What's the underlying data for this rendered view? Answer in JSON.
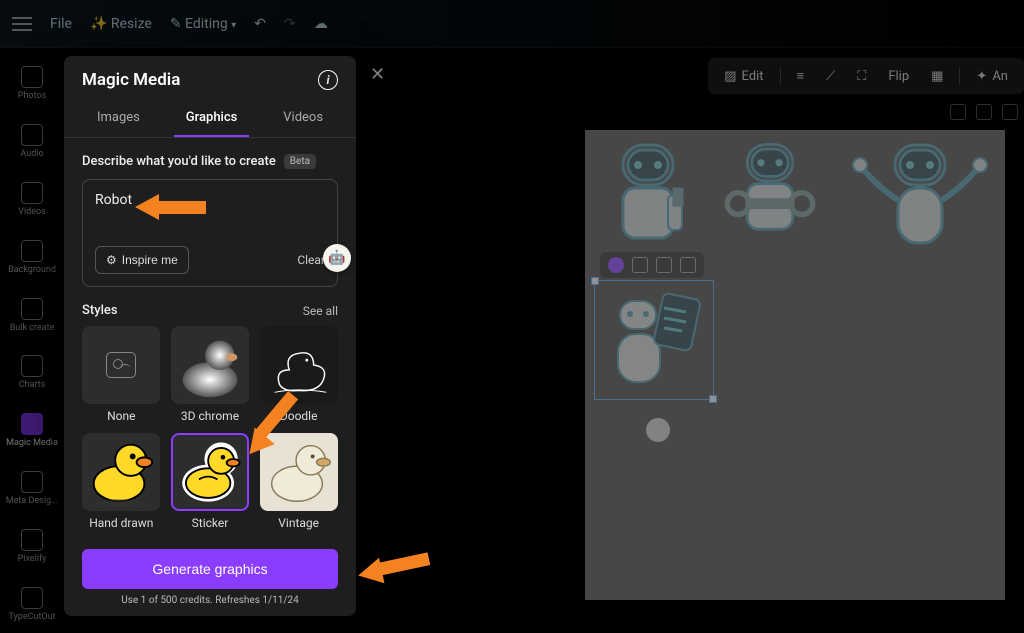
{
  "top_bar": {
    "file": "File",
    "resize": "Resize",
    "editing": "Editing"
  },
  "sidebar": {
    "items": [
      {
        "label": "Photos"
      },
      {
        "label": "Audio"
      },
      {
        "label": "Videos"
      },
      {
        "label": "Background"
      },
      {
        "label": "Bulk create"
      },
      {
        "label": "Charts"
      },
      {
        "label": "Magic Media"
      },
      {
        "label": "Meta Desig..."
      },
      {
        "label": "Pixelify"
      },
      {
        "label": "TypeCutOut"
      }
    ]
  },
  "panel": {
    "title": "Magic Media",
    "tabs": {
      "images": "Images",
      "graphics": "Graphics",
      "videos": "Videos"
    },
    "describe_label": "Describe what you'd like to create",
    "beta": "Beta",
    "prompt": "Robot",
    "inspire": "Inspire me",
    "clear": "Clear",
    "styles_label": "Styles",
    "see_all": "See all",
    "styles": [
      {
        "name": "None"
      },
      {
        "name": "3D chrome"
      },
      {
        "name": "Doodle"
      },
      {
        "name": "Hand drawn"
      },
      {
        "name": "Sticker"
      },
      {
        "name": "Vintage"
      }
    ],
    "generate": "Generate graphics",
    "credits": "Use 1 of 500 credits. Refreshes 1/11/24"
  },
  "float_toolbar": {
    "edit": "Edit",
    "flip": "Flip",
    "animate": "An"
  }
}
